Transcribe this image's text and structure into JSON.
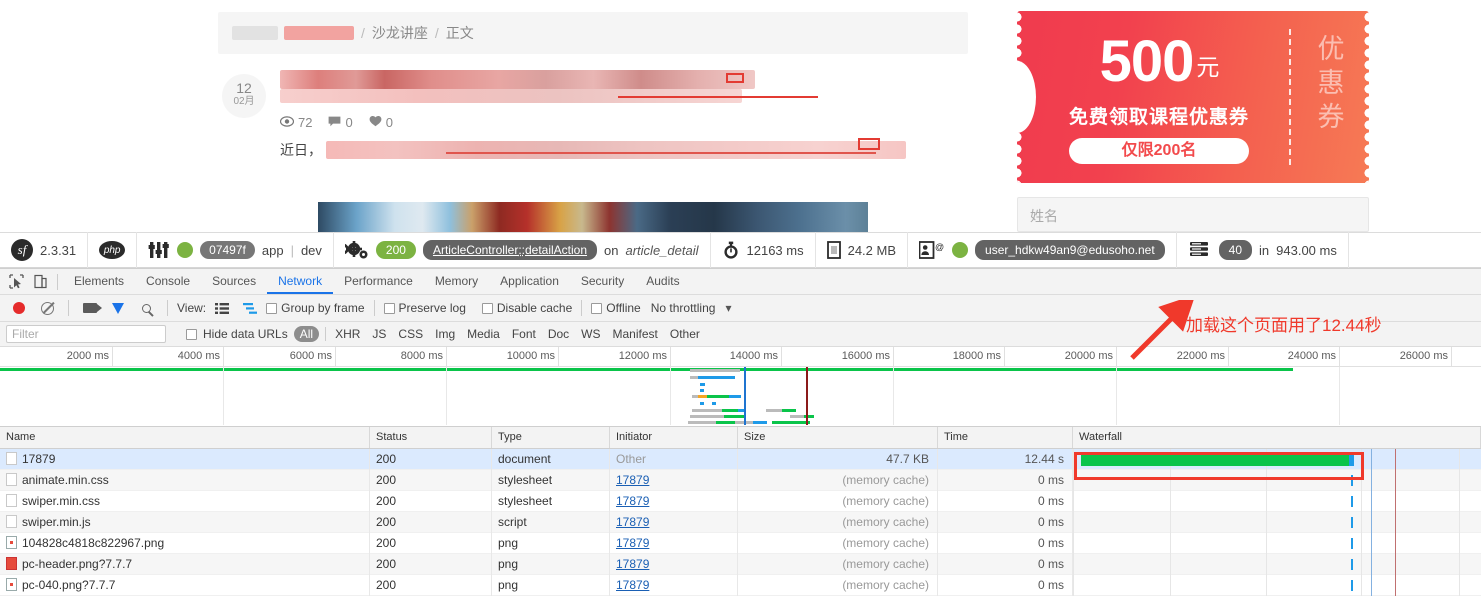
{
  "page": {
    "breadcrumb": {
      "sep": "/",
      "items": [
        "沙龙讲座",
        "正文"
      ]
    },
    "post": {
      "day": "12",
      "month": "02月",
      "views": "72",
      "comments": "0",
      "likes": "0",
      "body_prefix": "近日，"
    },
    "promo": {
      "amount": "500",
      "unit": "元",
      "desc": "免费领取课程优惠券",
      "limit": "仅限200名",
      "vertical": "优惠券",
      "name_placeholder": "姓名"
    }
  },
  "symfony_toolbar": {
    "version": "2.3.31",
    "php_label": "php",
    "config_hash": "07497f",
    "env_app": "app",
    "env_sep": "|",
    "env": "dev",
    "status_code": "200",
    "controller": "ArticleController",
    "controller_sep": "::",
    "action": "detailAction",
    "on_word": "on",
    "route": "article_detail",
    "time": "12163 ms",
    "memory": "24.2 MB",
    "user": "user_hdkw49an9@edusoho.net",
    "db_queries": "40",
    "db_time_prefix": "in",
    "db_time": "943.00 ms"
  },
  "devtools": {
    "tabs": [
      "Elements",
      "Console",
      "Sources",
      "Network",
      "Performance",
      "Memory",
      "Application",
      "Security",
      "Audits"
    ],
    "active_tab": "Network",
    "toolbar": {
      "view_label": "View:",
      "group_by_frame": "Group by frame",
      "preserve_log": "Preserve log",
      "disable_cache": "Disable cache",
      "offline": "Offline",
      "throttling": "No throttling"
    },
    "filterbar": {
      "filter_placeholder": "Filter",
      "hide_data_urls": "Hide data URLs",
      "types": [
        "All",
        "XHR",
        "JS",
        "CSS",
        "Img",
        "Media",
        "Font",
        "Doc",
        "WS",
        "Manifest",
        "Other"
      ],
      "active_type": "All"
    },
    "timeline_ticks": [
      "2000 ms",
      "4000 ms",
      "6000 ms",
      "8000 ms",
      "10000 ms",
      "12000 ms",
      "14000 ms",
      "16000 ms",
      "18000 ms",
      "20000 ms",
      "22000 ms",
      "24000 ms",
      "26000 ms"
    ],
    "columns": [
      "Name",
      "Status",
      "Type",
      "Initiator",
      "Size",
      "Time",
      "Waterfall"
    ],
    "rows": [
      {
        "name": "17879",
        "status": "200",
        "type": "document",
        "initiator": "Other",
        "size": "47.7 KB",
        "time": "12.44 s",
        "icon": "document-icon",
        "selected": true
      },
      {
        "name": "animate.min.css",
        "status": "200",
        "type": "stylesheet",
        "initiator": "17879",
        "size": "(memory cache)",
        "time": "0 ms",
        "icon": "stylesheet-icon",
        "selected": false
      },
      {
        "name": "swiper.min.css",
        "status": "200",
        "type": "stylesheet",
        "initiator": "17879",
        "size": "(memory cache)",
        "time": "0 ms",
        "icon": "stylesheet-icon",
        "selected": false
      },
      {
        "name": "swiper.min.js",
        "status": "200",
        "type": "script",
        "initiator": "17879",
        "size": "(memory cache)",
        "time": "0 ms",
        "icon": "script-icon",
        "selected": false
      },
      {
        "name": "104828c4818c822967.png",
        "status": "200",
        "type": "png",
        "initiator": "17879",
        "size": "(memory cache)",
        "time": "0 ms",
        "icon": "image-icon",
        "selected": false
      },
      {
        "name": "pc-header.png?7.7.7",
        "status": "200",
        "type": "png",
        "initiator": "17879",
        "size": "(memory cache)",
        "time": "0 ms",
        "icon": "image-red-icon",
        "selected": false
      },
      {
        "name": "pc-040.png?7.7.7",
        "status": "200",
        "type": "png",
        "initiator": "17879",
        "size": "(memory cache)",
        "time": "0 ms",
        "icon": "image-icon",
        "selected": false
      }
    ]
  },
  "annotation": {
    "text": "加载这个页面用了12.44秒",
    "color": "#f0392b"
  }
}
